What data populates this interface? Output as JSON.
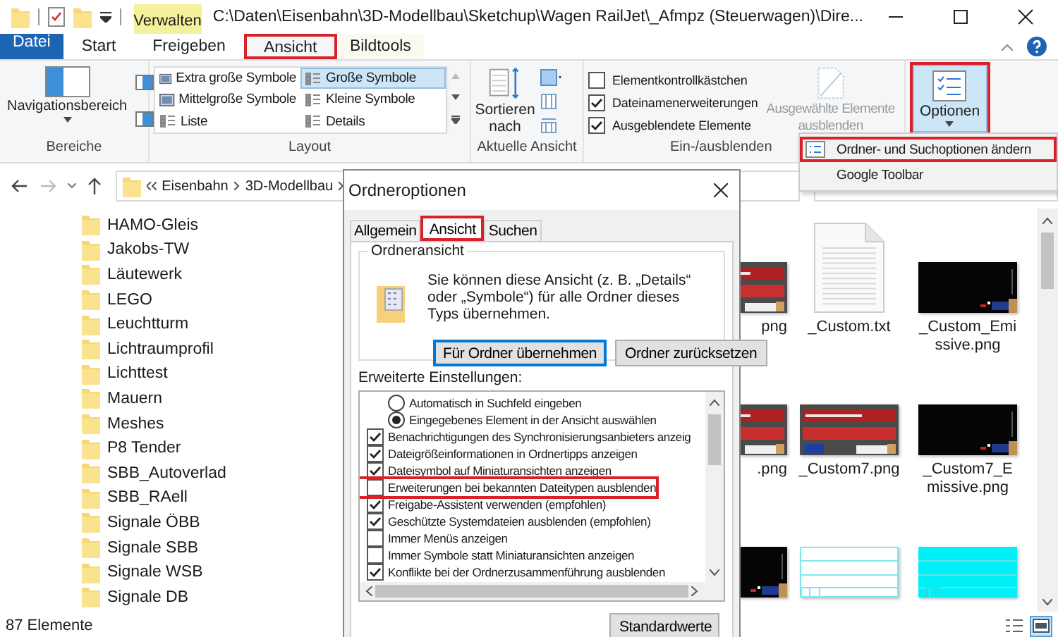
{
  "title_bar": {
    "context_tab": "Verwalten",
    "title": "C:\\Daten\\Eisenbahn\\3D-Modellbau\\Sketchup\\Wagen RailJet\\_Afmpz (Steuerwagen)\\Dire..."
  },
  "ribbon_tabs": [
    {
      "label": "Datei",
      "kind": "file",
      "selected": false,
      "highlighted": false
    },
    {
      "label": "Start",
      "kind": "tab",
      "selected": false,
      "highlighted": false
    },
    {
      "label": "Freigeben",
      "kind": "tab",
      "selected": false,
      "highlighted": false
    },
    {
      "label": "Ansicht",
      "kind": "tab",
      "selected": true,
      "highlighted": true
    },
    {
      "label": "Bildtools",
      "kind": "context",
      "selected": false,
      "highlighted": false
    }
  ],
  "ribbon": {
    "panes": {
      "button": "Navigationsbereich",
      "label": "Bereiche"
    },
    "layout": {
      "label": "Layout",
      "items": [
        {
          "label": "Extra große Symbole",
          "selected": false
        },
        {
          "label": "Große Symbole",
          "selected": true
        },
        {
          "label": "Mittelgroße Symbole",
          "selected": false
        },
        {
          "label": "Kleine Symbole",
          "selected": false
        },
        {
          "label": "Liste",
          "selected": false
        },
        {
          "label": "Details",
          "selected": false
        }
      ]
    },
    "current_view": {
      "button": "Sortieren nach",
      "label": "Aktuelle Ansicht"
    },
    "show_hide": {
      "label": "Ein-/ausblenden",
      "checkboxes": [
        {
          "label": "Elementkontrollkästchen",
          "checked": false
        },
        {
          "label": "Dateinamenerweiterungen",
          "checked": true
        },
        {
          "label": "Ausgeblendete Elemente",
          "checked": true
        }
      ],
      "hide_button": {
        "label": "Ausgewählte Elemente ausblenden",
        "disabled": true
      }
    },
    "options": {
      "button": "Optionen",
      "highlighted": true
    }
  },
  "options_menu": [
    {
      "label": "Ordner- und Suchoptionen ändern",
      "highlighted": true
    },
    {
      "label": "Google Toolbar",
      "highlighted": false
    }
  ],
  "address_bar": {
    "crumbs": [
      "Eisenbahn",
      "3D-Modellbau"
    ]
  },
  "folders": [
    "HAMO-Gleis",
    "Jakobs-TW",
    "Läutewerk",
    "LEGO",
    "Leuchtturm",
    "Lichtraumprofil",
    "Lichttest",
    "Mauern",
    "Meshes",
    "P8 Tender",
    "SBB_Autoverlad",
    "SBB_RAell",
    "Signale ÖBB",
    "Signale SBB",
    "Signale WSB",
    "Signale DB"
  ],
  "files": [
    {
      "name": "png",
      "kind": "picture"
    },
    {
      "name": "_Custom.txt",
      "kind": "document"
    },
    {
      "name": "_Custom_Emissive.png",
      "kind": "picture"
    },
    {
      "name": ".png",
      "kind": "picture"
    },
    {
      "name": "_Custom7.png",
      "kind": "picture"
    },
    {
      "name": "_Custom7_Emissive.png",
      "kind": "picture"
    },
    {
      "kind": "picture"
    },
    {
      "kind": "picture"
    },
    {
      "kind": "picture"
    }
  ],
  "status_bar": {
    "count": "87 Elemente",
    "view_buttons": [
      {
        "kind": "details",
        "selected": false
      },
      {
        "kind": "large-icons",
        "selected": true
      }
    ]
  },
  "dialog": {
    "title": "Ordneroptionen",
    "tabs": [
      {
        "label": "Allgemein",
        "selected": false,
        "highlighted": false
      },
      {
        "label": "Ansicht",
        "selected": true,
        "highlighted": true
      },
      {
        "label": "Suchen",
        "selected": false,
        "highlighted": false
      }
    ],
    "folder_view": {
      "label": "Ordneransicht",
      "text": "Sie können diese Ansicht (z. B. „Details“ oder „Symbole“) für alle Ordner dieses Typs übernehmen.",
      "buttons": [
        "Für Ordner übernehmen",
        "Ordner zurücksetzen"
      ]
    },
    "advanced_label": "Erweiterte Einstellungen:",
    "settings": [
      {
        "kind": "radio",
        "label": "Automatisch in Suchfeld eingeben",
        "checked": false,
        "highlighted": false
      },
      {
        "kind": "radio",
        "label": "Eingegebenes Element in der Ansicht auswählen",
        "checked": true,
        "highlighted": false
      },
      {
        "kind": "checkbox",
        "label": "Benachrichtigungen des Synchronisierungsanbieters anzeig",
        "checked": true,
        "highlighted": false
      },
      {
        "kind": "checkbox",
        "label": "Dateigrößeinformationen in Ordnertipps anzeigen",
        "checked": true,
        "highlighted": false
      },
      {
        "kind": "checkbox",
        "label": "Dateisymbol auf Miniaturansichten anzeigen",
        "checked": true,
        "highlighted": false
      },
      {
        "kind": "checkbox",
        "label": "Erweiterungen bei bekannten Dateitypen ausblenden",
        "checked": false,
        "highlighted": true
      },
      {
        "kind": "checkbox",
        "label": "Freigabe-Assistent verwenden (empfohlen)",
        "checked": true,
        "highlighted": false
      },
      {
        "kind": "checkbox",
        "label": "Geschützte Systemdateien ausblenden (empfohlen)",
        "checked": true,
        "highlighted": false
      },
      {
        "kind": "checkbox",
        "label": "Immer Menüs anzeigen",
        "checked": false,
        "highlighted": false
      },
      {
        "kind": "checkbox",
        "label": "Immer Symbole statt Miniaturansichten anzeigen",
        "checked": false,
        "highlighted": false
      },
      {
        "kind": "checkbox",
        "label": "Konflikte bei der Ordnerzusammenführung ausblenden",
        "checked": true,
        "highlighted": false
      }
    ],
    "default_button": "Standardwerte"
  }
}
